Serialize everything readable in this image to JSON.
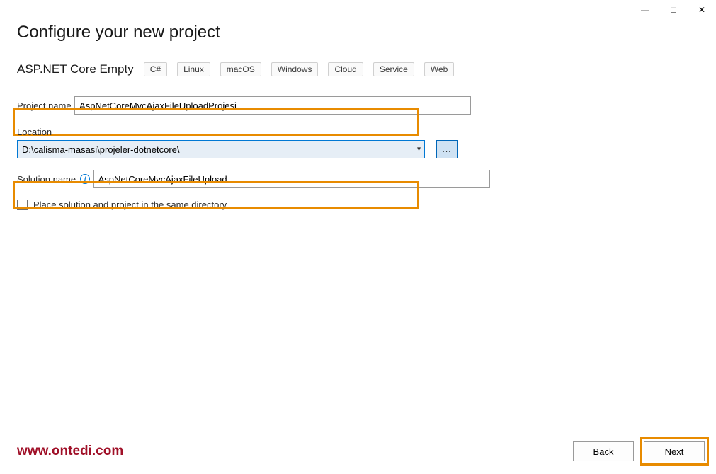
{
  "titlebar": {
    "minimize": "—",
    "maximize": "□",
    "close": "✕"
  },
  "page_title": "Configure your new project",
  "template": {
    "name": "ASP.NET Core Empty",
    "tags": [
      "C#",
      "Linux",
      "macOS",
      "Windows",
      "Cloud",
      "Service",
      "Web"
    ]
  },
  "fields": {
    "project_name_label": "Project name",
    "project_name_value": "AspNetCoreMvcAjaxFileUploadProjesi",
    "location_label": "Location",
    "location_value": "D:\\calisma-masasi\\projeler-dotnetcore\\",
    "browse_label": "...",
    "solution_name_label": "Solution name",
    "solution_name_value": "AspNetCoreMvcAjaxFileUpload",
    "same_directory_label": "Place solution and project in the same directory"
  },
  "footer": {
    "watermark": "www.ontedi.com",
    "back": "Back",
    "next": "Next"
  }
}
